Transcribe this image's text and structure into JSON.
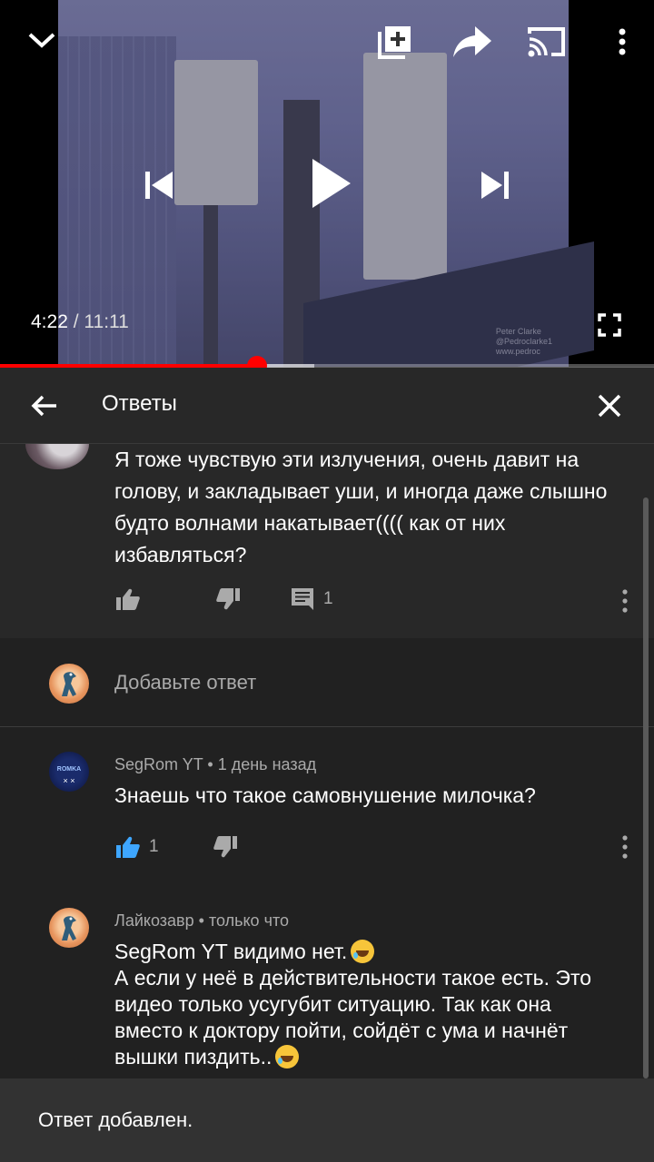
{
  "player": {
    "current_time": "4:22",
    "separator": "/",
    "duration": "11:11",
    "progress_fraction": 0.393,
    "buffered_fraction": 0.48,
    "video_credit": [
      "Peter Clarke",
      "@Pedroclarke1",
      "www.pedroc"
    ]
  },
  "panel": {
    "title": "Ответы"
  },
  "parent_comment": {
    "text": "Я тоже чувствую эти излучения, очень давит на голову, и закладывает уши, и иногда даже слышно будто волнами накатывает(((( как от них избавляться?",
    "reply_count": "1"
  },
  "add_reply": {
    "placeholder": "Добавьте ответ"
  },
  "replies": [
    {
      "author": "SegRom YT",
      "time": "1 день назад",
      "text": "Знаешь что такое самовнушение милочка?",
      "likes": "1",
      "avatar_label": "ROMKA"
    },
    {
      "author": "Лайкозавр",
      "time": "только что",
      "lines": [
        "SegRom YT видимо нет.",
        "А если у неё в действительности такое есть. Это видео только усугубит ситуацию. Так как она вместо к доктору пойти, сойдёт с ума и начнёт вышки пиздить.."
      ]
    }
  ],
  "toast": {
    "message": "Ответ добавлен."
  },
  "colors": {
    "accent_red": "#ff0000",
    "like_active": "#3ea6ff",
    "background": "#212121"
  }
}
